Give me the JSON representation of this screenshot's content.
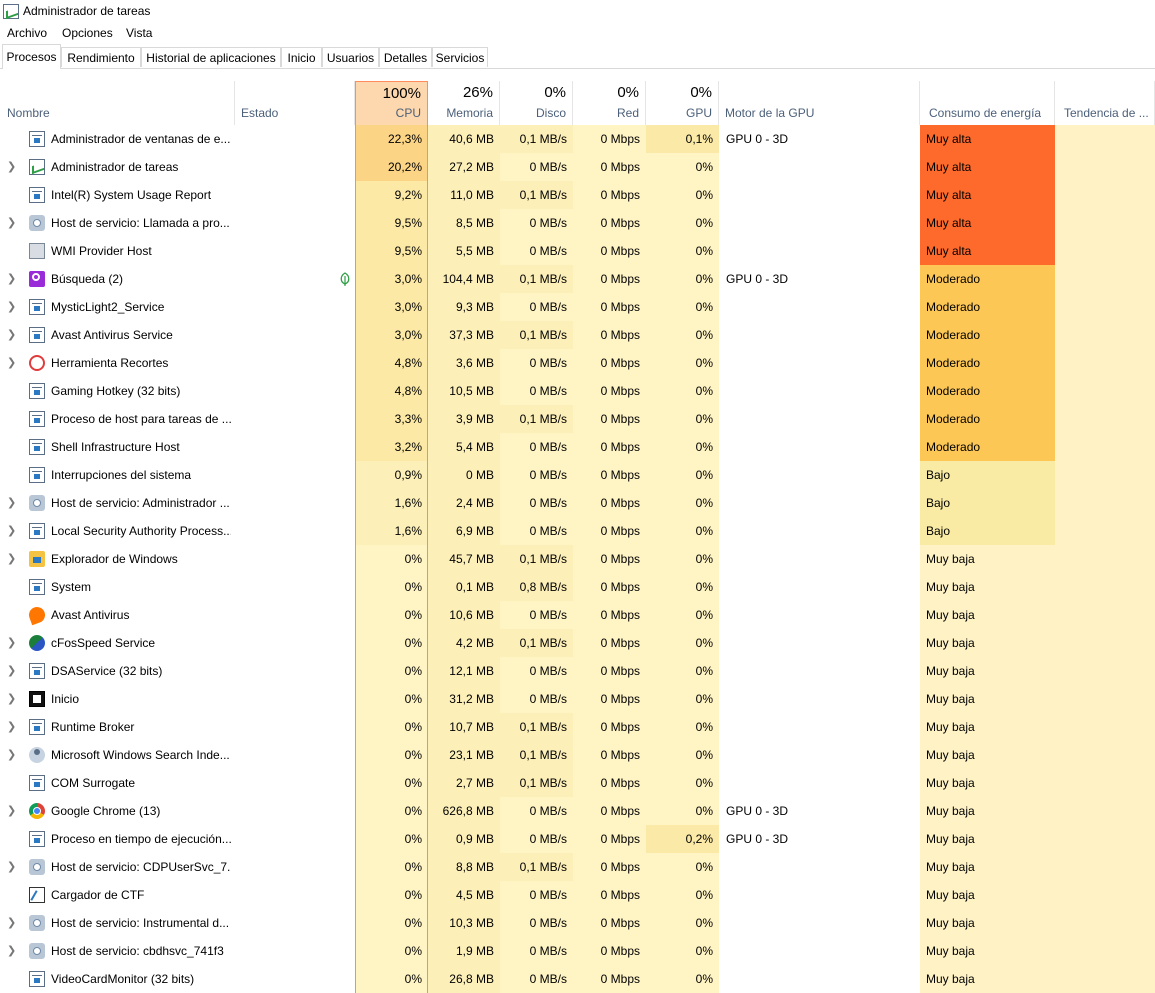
{
  "window": {
    "title": "Administrador de tareas"
  },
  "menu": [
    "Archivo",
    "Opciones",
    "Vista"
  ],
  "tabs": [
    "Procesos",
    "Rendimiento",
    "Historial de aplicaciones",
    "Inicio",
    "Usuarios",
    "Detalles",
    "Servicios"
  ],
  "columns": {
    "name": "Nombre",
    "status": "Estado",
    "cpu": {
      "pct": "100%",
      "label": "CPU"
    },
    "mem": {
      "pct": "26%",
      "label": "Memoria"
    },
    "disk": {
      "pct": "0%",
      "label": "Disco"
    },
    "net": {
      "pct": "0%",
      "label": "Red"
    },
    "gpu": {
      "pct": "0%",
      "label": "GPU"
    },
    "gpu_engine": "Motor de la GPU",
    "power": "Consumo de energía",
    "power_trend": "Tendencia de ..."
  },
  "colors": {
    "muy_alta": "#fd6a2b",
    "moderado": "#fdc756",
    "bajo": "#f9eaa4",
    "muy_baja": "#fff3c6",
    "cpu_hi": "#fbd486",
    "cpu_mid": "#fce9a6",
    "cpu_lo": "#fcefb8",
    "cell": "#fff4c4",
    "gpu_hi": "#fbe9a7"
  },
  "processes": [
    {
      "name": "Administrador de ventanas de e...",
      "expand": false,
      "icon": "window-icon",
      "cpu": "22,3%",
      "mem": "40,6 MB",
      "disk": "0,1 MB/s",
      "net": "0 Mbps",
      "gpu": "0,1%",
      "engine": "GPU 0 - 3D",
      "power": "Muy alta"
    },
    {
      "name": "Administrador de tareas",
      "expand": true,
      "icon": "task-manager-icon",
      "cpu": "20,2%",
      "mem": "27,2 MB",
      "disk": "0 MB/s",
      "net": "0 Mbps",
      "gpu": "0%",
      "engine": "",
      "power": "Muy alta"
    },
    {
      "name": "Intel(R) System Usage Report",
      "expand": false,
      "icon": "window-icon",
      "cpu": "9,2%",
      "mem": "11,0 MB",
      "disk": "0,1 MB/s",
      "net": "0 Mbps",
      "gpu": "0%",
      "engine": "",
      "power": "Muy alta"
    },
    {
      "name": "Host de servicio: Llamada a pro...",
      "expand": true,
      "icon": "gear-icon",
      "cpu": "9,5%",
      "mem": "8,5 MB",
      "disk": "0 MB/s",
      "net": "0 Mbps",
      "gpu": "0%",
      "engine": "",
      "power": "Muy alta"
    },
    {
      "name": "WMI Provider Host",
      "expand": false,
      "icon": "wmi-icon",
      "cpu": "9,5%",
      "mem": "5,5 MB",
      "disk": "0 MB/s",
      "net": "0 Mbps",
      "gpu": "0%",
      "engine": "",
      "power": "Muy alta"
    },
    {
      "name": "Búsqueda (2)",
      "expand": true,
      "icon": "search-icon",
      "leaf": true,
      "cpu": "3,0%",
      "mem": "104,4 MB",
      "disk": "0,1 MB/s",
      "net": "0 Mbps",
      "gpu": "0%",
      "engine": "GPU 0 - 3D",
      "power": "Moderado"
    },
    {
      "name": "MysticLight2_Service",
      "expand": true,
      "icon": "window-icon",
      "cpu": "3,0%",
      "mem": "9,3 MB",
      "disk": "0 MB/s",
      "net": "0 Mbps",
      "gpu": "0%",
      "engine": "",
      "power": "Moderado"
    },
    {
      "name": "Avast Antivirus  Service",
      "expand": true,
      "icon": "window-icon",
      "cpu": "3,0%",
      "mem": "37,3 MB",
      "disk": "0,1 MB/s",
      "net": "0 Mbps",
      "gpu": "0%",
      "engine": "",
      "power": "Moderado"
    },
    {
      "name": "Herramienta Recortes",
      "expand": true,
      "icon": "snip-icon",
      "cpu": "4,8%",
      "mem": "3,6 MB",
      "disk": "0 MB/s",
      "net": "0 Mbps",
      "gpu": "0%",
      "engine": "",
      "power": "Moderado"
    },
    {
      "name": "Gaming Hotkey (32 bits)",
      "expand": false,
      "icon": "window-icon",
      "cpu": "4,8%",
      "mem": "10,5 MB",
      "disk": "0 MB/s",
      "net": "0 Mbps",
      "gpu": "0%",
      "engine": "",
      "power": "Moderado"
    },
    {
      "name": "Proceso de host para tareas de ...",
      "expand": false,
      "icon": "window-icon",
      "cpu": "3,3%",
      "mem": "3,9 MB",
      "disk": "0,1 MB/s",
      "net": "0 Mbps",
      "gpu": "0%",
      "engine": "",
      "power": "Moderado"
    },
    {
      "name": "Shell Infrastructure Host",
      "expand": false,
      "icon": "window-icon",
      "cpu": "3,2%",
      "mem": "5,4 MB",
      "disk": "0 MB/s",
      "net": "0 Mbps",
      "gpu": "0%",
      "engine": "",
      "power": "Moderado"
    },
    {
      "name": "Interrupciones del sistema",
      "expand": false,
      "icon": "window-icon",
      "cpu": "0,9%",
      "mem": "0 MB",
      "disk": "0 MB/s",
      "net": "0 Mbps",
      "gpu": "0%",
      "engine": "",
      "power": "Bajo"
    },
    {
      "name": "Host de servicio: Administrador ...",
      "expand": true,
      "icon": "gear-icon",
      "cpu": "1,6%",
      "mem": "2,4 MB",
      "disk": "0 MB/s",
      "net": "0 Mbps",
      "gpu": "0%",
      "engine": "",
      "power": "Bajo"
    },
    {
      "name": "Local Security Authority Process...",
      "expand": true,
      "icon": "window-icon",
      "cpu": "1,6%",
      "mem": "6,9 MB",
      "disk": "0 MB/s",
      "net": "0 Mbps",
      "gpu": "0%",
      "engine": "",
      "power": "Bajo"
    },
    {
      "name": "Explorador de Windows",
      "expand": true,
      "icon": "folder-icon",
      "cpu": "0%",
      "mem": "45,7 MB",
      "disk": "0,1 MB/s",
      "net": "0 Mbps",
      "gpu": "0%",
      "engine": "",
      "power": "Muy baja"
    },
    {
      "name": "System",
      "expand": false,
      "icon": "window-icon",
      "cpu": "0%",
      "mem": "0,1 MB",
      "disk": "0,8 MB/s",
      "net": "0 Mbps",
      "gpu": "0%",
      "engine": "",
      "power": "Muy baja"
    },
    {
      "name": "Avast Antivirus",
      "expand": false,
      "icon": "avast-icon",
      "cpu": "0%",
      "mem": "10,6 MB",
      "disk": "0 MB/s",
      "net": "0 Mbps",
      "gpu": "0%",
      "engine": "",
      "power": "Muy baja"
    },
    {
      "name": "cFosSpeed Service",
      "expand": true,
      "icon": "cfos-icon",
      "cpu": "0%",
      "mem": "4,2 MB",
      "disk": "0,1 MB/s",
      "net": "0 Mbps",
      "gpu": "0%",
      "engine": "",
      "power": "Muy baja"
    },
    {
      "name": "DSAService (32 bits)",
      "expand": true,
      "icon": "window-icon",
      "cpu": "0%",
      "mem": "12,1 MB",
      "disk": "0 MB/s",
      "net": "0 Mbps",
      "gpu": "0%",
      "engine": "",
      "power": "Muy baja"
    },
    {
      "name": "Inicio",
      "expand": true,
      "icon": "start-icon",
      "cpu": "0%",
      "mem": "31,2 MB",
      "disk": "0 MB/s",
      "net": "0 Mbps",
      "gpu": "0%",
      "engine": "",
      "power": "Muy baja"
    },
    {
      "name": "Runtime Broker",
      "expand": true,
      "icon": "window-icon",
      "cpu": "0%",
      "mem": "10,7 MB",
      "disk": "0,1 MB/s",
      "net": "0 Mbps",
      "gpu": "0%",
      "engine": "",
      "power": "Muy baja"
    },
    {
      "name": "Microsoft Windows Search Inde...",
      "expand": true,
      "icon": "user-icon",
      "cpu": "0%",
      "mem": "23,1 MB",
      "disk": "0,1 MB/s",
      "net": "0 Mbps",
      "gpu": "0%",
      "engine": "",
      "power": "Muy baja"
    },
    {
      "name": "COM Surrogate",
      "expand": false,
      "icon": "window-icon",
      "cpu": "0%",
      "mem": "2,7 MB",
      "disk": "0,1 MB/s",
      "net": "0 Mbps",
      "gpu": "0%",
      "engine": "",
      "power": "Muy baja"
    },
    {
      "name": "Google Chrome (13)",
      "expand": true,
      "icon": "chrome-icon",
      "cpu": "0%",
      "mem": "626,8 MB",
      "disk": "0 MB/s",
      "net": "0 Mbps",
      "gpu": "0%",
      "engine": "GPU 0 - 3D",
      "power": "Muy baja"
    },
    {
      "name": "Proceso en tiempo de ejecución...",
      "expand": false,
      "icon": "window-icon",
      "cpu": "0%",
      "mem": "0,9 MB",
      "disk": "0 MB/s",
      "net": "0 Mbps",
      "gpu": "0,2%",
      "engine": "GPU 0 - 3D",
      "power": "Muy baja"
    },
    {
      "name": "Host de servicio: CDPUserSvc_7...",
      "expand": true,
      "icon": "gear-icon",
      "cpu": "0%",
      "mem": "8,8 MB",
      "disk": "0,1 MB/s",
      "net": "0 Mbps",
      "gpu": "0%",
      "engine": "",
      "power": "Muy baja"
    },
    {
      "name": "Cargador de CTF",
      "expand": false,
      "icon": "ctf-icon",
      "cpu": "0%",
      "mem": "4,5 MB",
      "disk": "0 MB/s",
      "net": "0 Mbps",
      "gpu": "0%",
      "engine": "",
      "power": "Muy baja"
    },
    {
      "name": "Host de servicio: Instrumental d...",
      "expand": true,
      "icon": "gear-icon",
      "cpu": "0%",
      "mem": "10,3 MB",
      "disk": "0 MB/s",
      "net": "0 Mbps",
      "gpu": "0%",
      "engine": "",
      "power": "Muy baja"
    },
    {
      "name": "Host de servicio: cbdhsvc_741f3",
      "expand": true,
      "icon": "gear-icon",
      "cpu": "0%",
      "mem": "1,9 MB",
      "disk": "0 MB/s",
      "net": "0 Mbps",
      "gpu": "0%",
      "engine": "",
      "power": "Muy baja"
    },
    {
      "name": "VideoCardMonitor (32 bits)",
      "expand": false,
      "icon": "window-icon",
      "cpu": "0%",
      "mem": "26,8 MB",
      "disk": "0 MB/s",
      "net": "0 Mbps",
      "gpu": "0%",
      "engine": "",
      "power": "Muy baja"
    }
  ]
}
